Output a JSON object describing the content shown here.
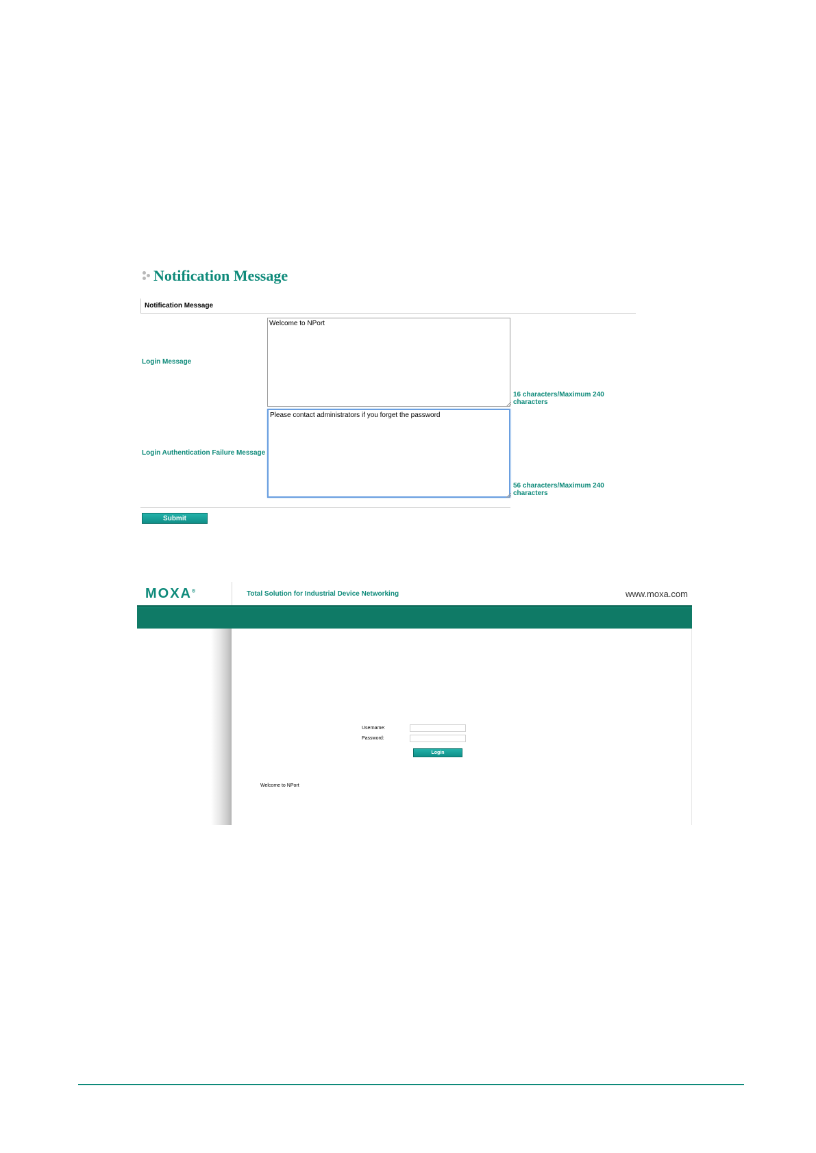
{
  "notification": {
    "title": "Notification Message",
    "section_header": "Notification Message",
    "login_message": {
      "label": "Login Message",
      "value": "Welcome to NPort",
      "count_text": "16 characters/Maximum 240 characters"
    },
    "failure_message": {
      "label": "Login Authentication Failure Message",
      "value": "Please contact administrators if you forget the password",
      "count_text": "56 characters/Maximum 240 characters"
    },
    "submit_label": "Submit"
  },
  "login_page": {
    "logo": "MOXA",
    "logo_mark": "®",
    "tagline": "Total Solution for Industrial Device Networking",
    "url": "www.moxa.com",
    "username_label": "Username:",
    "password_label": "Password:",
    "username_value": "",
    "password_value": "",
    "login_label": "Login",
    "welcome_text": "Welcome to NPort"
  },
  "colors": {
    "accent": "#0e8a7a",
    "header_bar": "#0f7a66",
    "button": "#1aa39b",
    "focus_border": "#6a9fe0"
  }
}
